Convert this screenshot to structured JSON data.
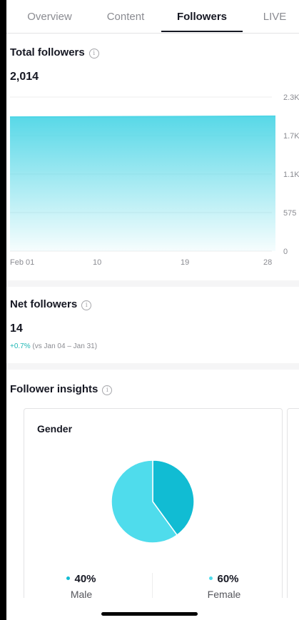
{
  "tabs": [
    {
      "label": "Overview"
    },
    {
      "label": "Content"
    },
    {
      "label": "Followers"
    },
    {
      "label": "LIVE"
    }
  ],
  "active_tab": "Followers",
  "total_followers": {
    "title": "Total followers",
    "value": "2,014"
  },
  "chart_data": {
    "type": "area",
    "x_ticks": [
      "Feb 01",
      "10",
      "19",
      "28"
    ],
    "y_ticks": [
      "2.3K",
      "1.7K",
      "1.1K",
      "575",
      "0"
    ],
    "ylim": [
      0,
      2300
    ],
    "x": [
      1,
      28
    ],
    "values": [
      2000,
      2014
    ],
    "grid": true,
    "color": "#4fd6e6"
  },
  "net_followers": {
    "title": "Net followers",
    "value": "14",
    "change": "+0.7%",
    "comparison": "(vs Jan 04 – Jan 31)"
  },
  "insights": {
    "title": "Follower insights",
    "gender": {
      "title": "Gender",
      "segments": [
        {
          "pct": "40%",
          "label": "Male",
          "value": 40,
          "color": "#11bcd3"
        },
        {
          "pct": "60%",
          "label": "Female",
          "value": 60,
          "color": "#4fdcec"
        }
      ]
    }
  },
  "info_icon_glyph": "i"
}
